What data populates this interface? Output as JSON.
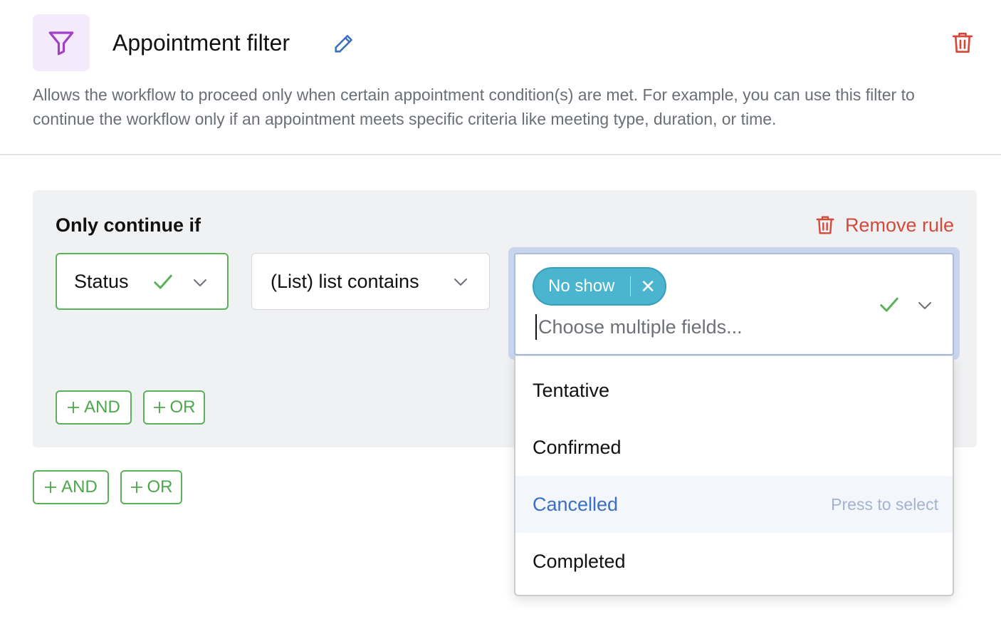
{
  "header": {
    "title": "Appointment filter",
    "description": "Allows the workflow to proceed only when certain appointment condition(s) are met. For example, you can use this filter to continue the workflow only if an appointment meets specific criteria like meeting type, duration, or time."
  },
  "rule": {
    "heading": "Only continue if",
    "remove_label": "Remove rule",
    "field_value": "Status",
    "operator_value": "(List) list contains",
    "multi_select": {
      "chips": [
        "No show"
      ],
      "placeholder": "Choose multiple fields...",
      "options": [
        {
          "label": "Tentative",
          "hint": ""
        },
        {
          "label": "Confirmed",
          "hint": ""
        },
        {
          "label": "Cancelled",
          "hint": "Press to select"
        },
        {
          "label": "Completed",
          "hint": ""
        }
      ],
      "highlighted_option": "Cancelled"
    },
    "inner_and_label": "AND",
    "inner_or_label": "OR"
  },
  "outer": {
    "and_label": "AND",
    "or_label": "OR"
  },
  "colors": {
    "accent_green": "#5bb15a",
    "danger_red": "#d24a3c",
    "chip_blue": "#4bb5cf",
    "filter_icon_purple": "#a040c8",
    "edit_blue": "#3b6fc4"
  },
  "icons": {
    "filter": "filter-icon",
    "edit": "pencil-icon",
    "delete": "trash-icon",
    "valid": "check-icon",
    "expand": "chevron-down-icon",
    "add": "plus-icon",
    "remove_chip": "close-icon"
  }
}
